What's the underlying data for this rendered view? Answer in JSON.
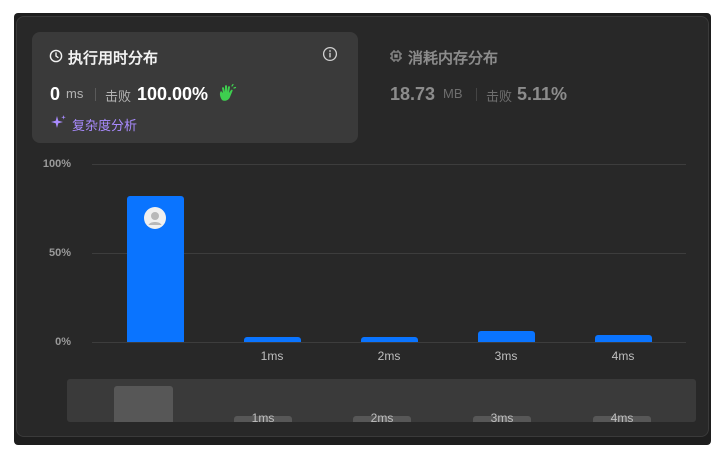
{
  "runtime": {
    "title": "执行用时分布",
    "value": "0",
    "unit": "ms",
    "beats_label": "击败",
    "beats_pct": "100.00%",
    "analysis_link": "复杂度分析",
    "icons": [
      "clock-icon",
      "info-icon",
      "clap-icon",
      "sparkle-icon"
    ]
  },
  "memory": {
    "title": "消耗内存分布",
    "value": "18.73",
    "unit": "MB",
    "beats_label": "击败",
    "beats_pct": "5.11%",
    "icons": [
      "chip-icon"
    ]
  },
  "chart_data": {
    "type": "bar",
    "categories": [
      "0ms",
      "1ms",
      "2ms",
      "3ms",
      "4ms"
    ],
    "category_labels": [
      "",
      "1ms",
      "2ms",
      "3ms",
      "4ms"
    ],
    "values": [
      82,
      3,
      3,
      6,
      4
    ],
    "yticks": [
      "0%",
      "50%",
      "100%"
    ],
    "ylim": [
      0,
      100
    ],
    "bar_color": "#0a74ff",
    "marked_category": "0ms"
  },
  "navigator": {
    "labels": [
      "1ms",
      "2ms",
      "3ms",
      "4ms"
    ]
  }
}
